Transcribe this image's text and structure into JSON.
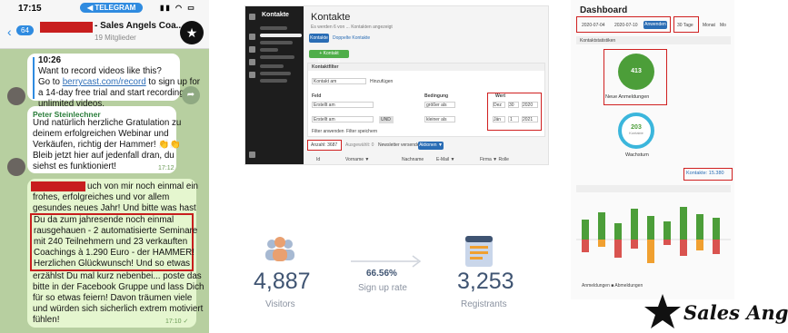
{
  "phone": {
    "status_time": "17:15",
    "telegram_pill": "◀ TELEGRAM",
    "status_icons": "▮▮ ◠ ▭",
    "back_badge": "64",
    "chat_title": "- Sales Angels Coa...",
    "chat_subtitle": "19 Mitglieder",
    "messages": [
      {
        "time": "10:26",
        "line1": "Want to record videos like this?",
        "line2_a": "Go to ",
        "line2_link": "berrycast.com/record",
        "line2_b": " to sign up for",
        "line3": "a 14-day free trial and start recording",
        "line4": "unlimited videos."
      },
      {
        "sender": "Peter Steinlechner",
        "lines": [
          "Und natürlich herzliche Gratulation zu",
          "deinem erfolgreichen Webinar und",
          "Verkäufen, richtig der Hammer! 👏👏",
          "Bleib jetzt hier auf jedenfall dran, du",
          "siehst es funktioniert!"
        ],
        "timestamp": "17:12"
      },
      {
        "lines_top": [
          "uch von mir noch einmal ein",
          "frohes, erfolgreiches und vor allem",
          "gesundes neues Jahr! Und bitte was hast"
        ],
        "highlight_lines": [
          "Du da zum jahresende noch einmal",
          "rausgehauen - 2 automatisierte Seminare",
          "mit 240 Teilnehmern und 23 verkauften",
          "Coachings à 1.290 Euro - der HAMMER!",
          "Herzlichen Glückwunsch! Und so etwas"
        ],
        "lines_bottom": [
          "erzählst Du mal kurz nebenbei... poste das",
          "bitte in der Facebook Gruppe und lass Dich",
          "für so etwas feiern! Davon träumen viele",
          "und würden sich sicherlich extrem motiviert",
          "fühlen!"
        ],
        "timestamp": "17:10 ✓"
      }
    ]
  },
  "kontakte": {
    "brand": "Kontakte",
    "title": "Kontakte",
    "subtitle": "Es werden 6 von ... Kontakten angezeigt",
    "tabs": [
      "Kontakte",
      "Doppelte Kontakte"
    ],
    "add_button": "+ Kontakt hinzufügen",
    "filter_label": "Kontaktfilter",
    "filter_field": "Kontakt am",
    "filter_add": "Hinzufügen",
    "cols": [
      "Feld",
      "Bedingung",
      "Wert"
    ],
    "rows": [
      {
        "field": "Erstellt am",
        "cond": "größer als",
        "val": [
          "Dez",
          "30",
          "2020"
        ]
      },
      {
        "field": "Erstellt am",
        "cond": "kleiner als",
        "val": [
          "Jän",
          "1",
          "2021"
        ],
        "op": "UND"
      }
    ],
    "filter_buttons": [
      "Filter anwenden",
      "Filter speichern"
    ],
    "count_tab": "Anzahl: 3687",
    "bottom_tabs": [
      "Ausgewählt: 0",
      "Newsletter versenden",
      "Aktionen ▼"
    ],
    "table_cols": [
      "Id",
      "Vorname ▼",
      "Nachname",
      "E-Mail ▼",
      "Firma ▼ Rolle"
    ]
  },
  "dashboard": {
    "title": "Dashboard",
    "date_from": "2020-07-04",
    "date_to": "2020-07-10",
    "apply_button": "Anwenden",
    "ranges": [
      "30 Tage",
      "Monat",
      "Mo"
    ],
    "section": "Kontaktstatistiken",
    "new_count": "413",
    "new_label": "Neue Anmeldungen",
    "ring_value": "203",
    "ring_sub": "Kontakte",
    "growth_label": "Wachstum",
    "kontakte_total": "Kontakte: 15.380",
    "legend": "Anmeldungen  ■ Abmeldungen"
  },
  "stats": {
    "visitors_value": "4,887",
    "visitors_label": "Visitors",
    "rate_value": "66.56%",
    "rate_label": "Sign up rate",
    "registrants_value": "3,253",
    "registrants_label": "Registrants"
  },
  "brand": {
    "name": "Sales Angels"
  },
  "colors": {
    "telegram_blue": "#2f8be0",
    "highlight_red": "#c81e1e",
    "success_green": "#4c9e39",
    "ring_blue": "#3bb6dc",
    "stat_text": "#3f5472"
  }
}
